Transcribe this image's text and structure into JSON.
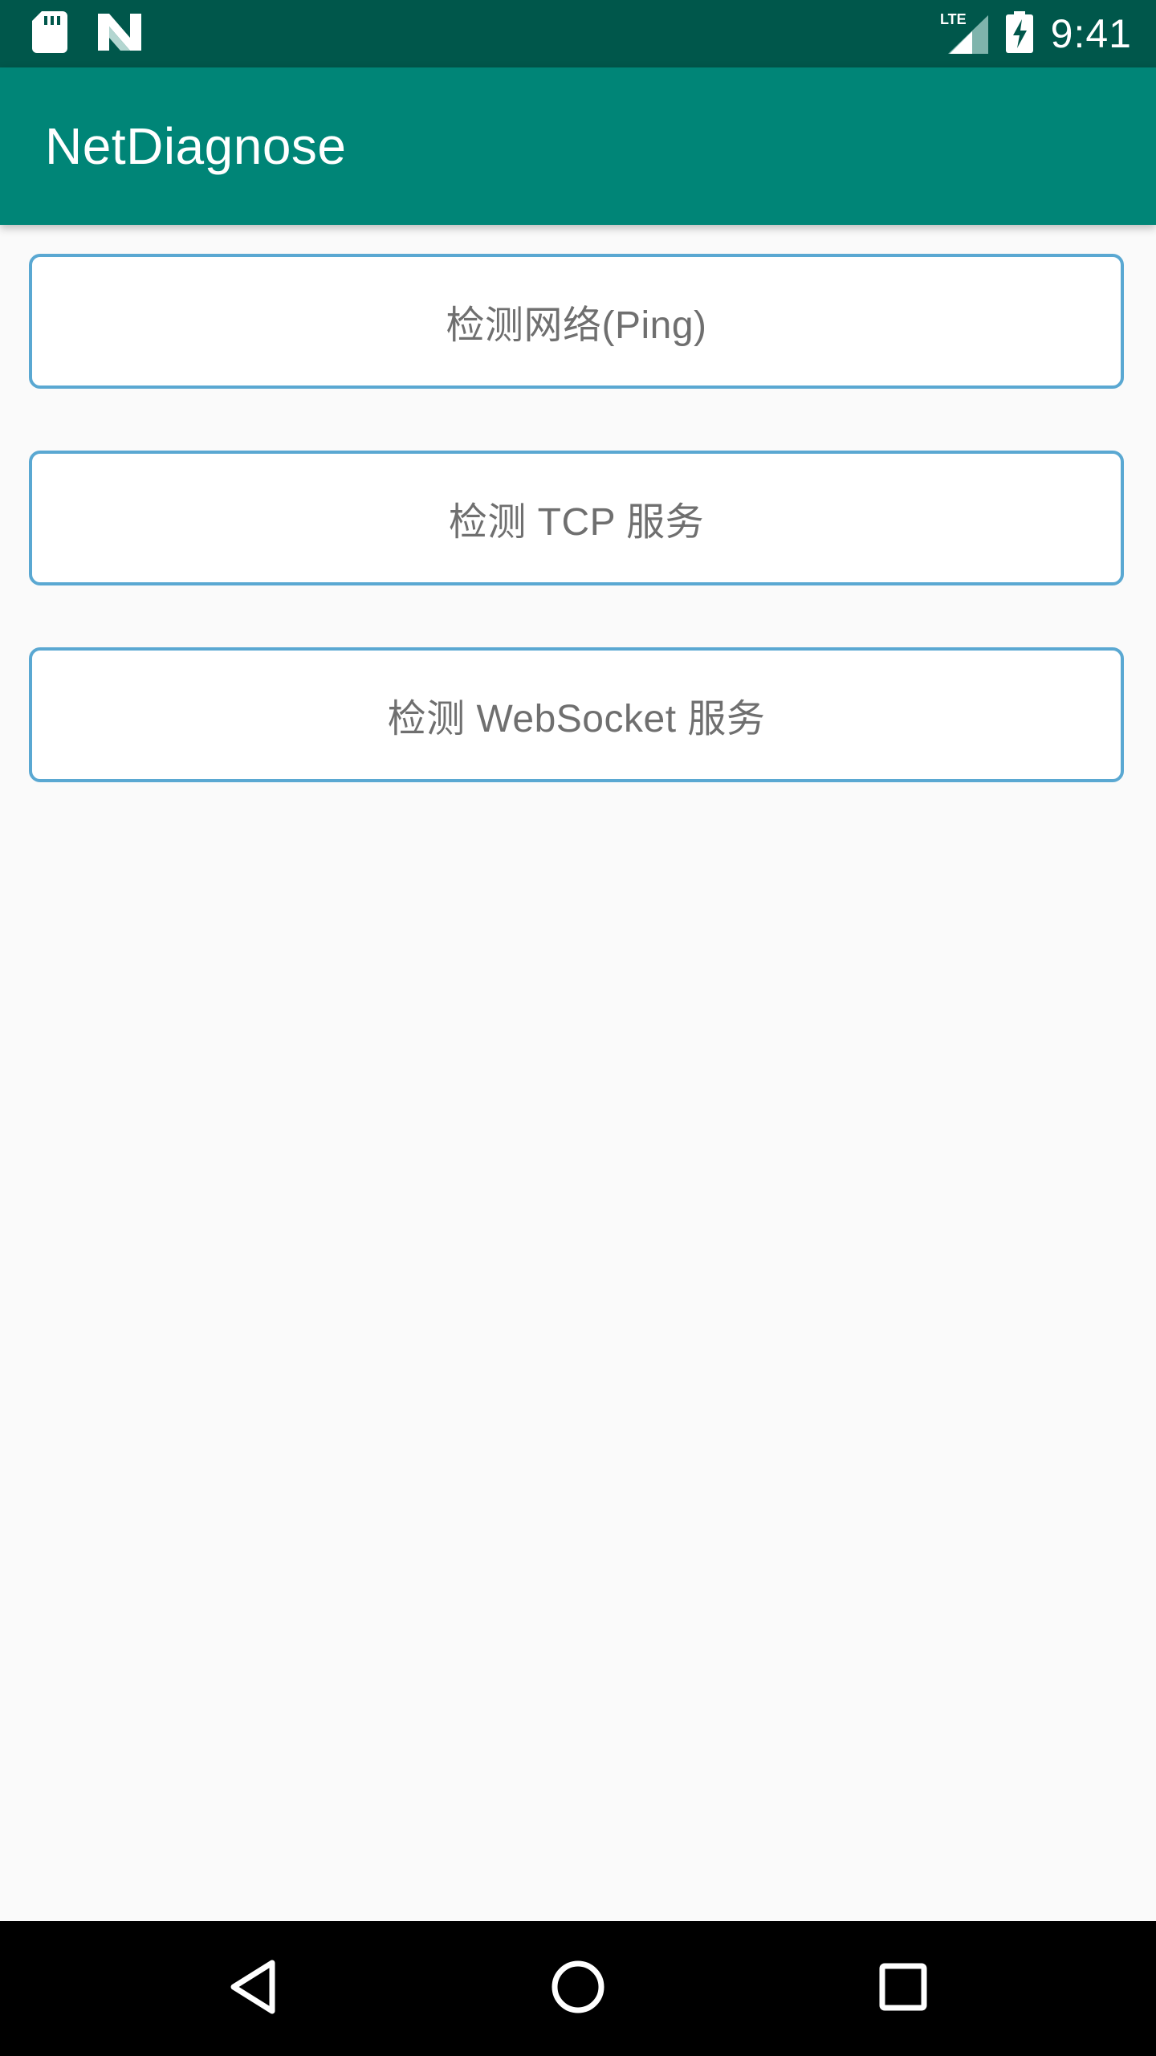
{
  "status_bar": {
    "time": "9:41",
    "network_label": "LTE",
    "icons": [
      "sd-card-icon",
      "n-logo-icon",
      "lte-signal-icon",
      "battery-charging-icon"
    ]
  },
  "app_bar": {
    "title": "NetDiagnose"
  },
  "buttons": [
    {
      "label": "检测网络(Ping)"
    },
    {
      "label": "检测 TCP 服务"
    },
    {
      "label": "检测 WebSocket 服务"
    }
  ],
  "nav_bar": {
    "icons": [
      "back-icon",
      "home-icon",
      "recents-icon"
    ]
  },
  "colors": {
    "status_bar": "#00574b",
    "app_bar": "#008577",
    "button_border": "#5aa8d2",
    "button_text": "#6f6f6f",
    "background": "#fafafa"
  }
}
